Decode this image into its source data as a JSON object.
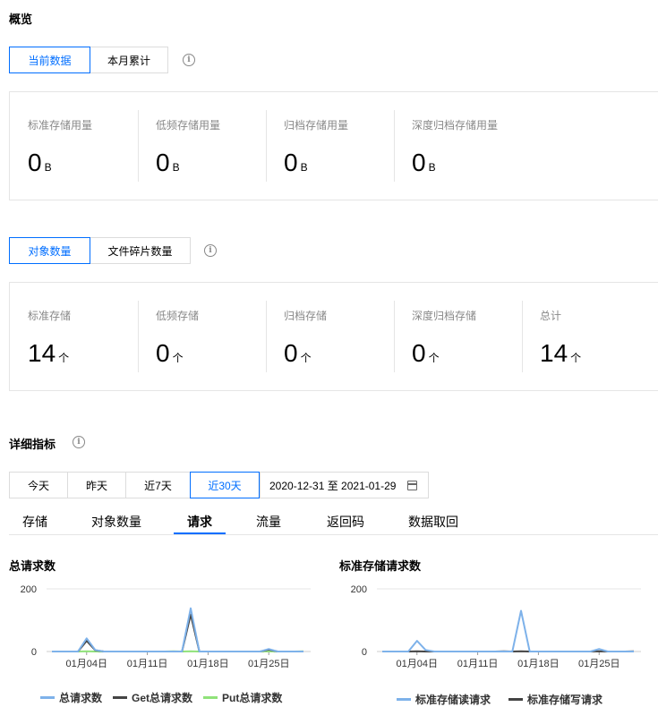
{
  "overview": {
    "title": "概览",
    "toggle": [
      "当前数据",
      "本月累计"
    ],
    "storage_metrics": [
      {
        "label": "标准存储用量",
        "value": "0",
        "unit": "B"
      },
      {
        "label": "低频存储用量",
        "value": "0",
        "unit": "B"
      },
      {
        "label": "归档存储用量",
        "value": "0",
        "unit": "B"
      },
      {
        "label": "深度归档存储用量",
        "value": "0",
        "unit": "B"
      }
    ],
    "count_toggle": [
      "对象数量",
      "文件碎片数量"
    ],
    "count_metrics": [
      {
        "label": "标准存储",
        "value": "14",
        "unit": "个"
      },
      {
        "label": "低频存储",
        "value": "0",
        "unit": "个"
      },
      {
        "label": "归档存储",
        "value": "0",
        "unit": "个"
      },
      {
        "label": "深度归档存储",
        "value": "0",
        "unit": "个"
      },
      {
        "label": "总计",
        "value": "14",
        "unit": "个"
      }
    ]
  },
  "details": {
    "title": "详细指标",
    "range_buttons": [
      "今天",
      "昨天",
      "近7天",
      "近30天"
    ],
    "date_range": "2020-12-31 至 2021-01-29",
    "tabs": [
      "存储",
      "对象数量",
      "请求",
      "流量",
      "返回码",
      "数据取回"
    ],
    "active_tab": "请求"
  },
  "colors": {
    "accent": "#006eff"
  },
  "chart_data": [
    {
      "type": "line",
      "title": "总请求数",
      "x": [
        "12-31",
        "01-01",
        "01-02",
        "01-03",
        "01-04",
        "01-05",
        "01-06",
        "01-07",
        "01-08",
        "01-09",
        "01-10",
        "01-11",
        "01-12",
        "01-13",
        "01-14",
        "01-15",
        "01-16",
        "01-17",
        "01-18",
        "01-19",
        "01-20",
        "01-21",
        "01-22",
        "01-23",
        "01-24",
        "01-25",
        "01-26",
        "01-27",
        "01-28",
        "01-29"
      ],
      "x_ticks": [
        "01月04日",
        "01月11日",
        "01月18日",
        "01月25日"
      ],
      "y_ticks": [
        0,
        200
      ],
      "ylim": [
        0,
        200
      ],
      "series": [
        {
          "name": "总请求数",
          "color": "#7eb2ea",
          "values": [
            0,
            0,
            0,
            0,
            42,
            5,
            0,
            0,
            0,
            0,
            0,
            0,
            0,
            0,
            0,
            0,
            138,
            0,
            0,
            0,
            0,
            0,
            0,
            0,
            0,
            8,
            0,
            0,
            0,
            0
          ]
        },
        {
          "name": "Get总请求数",
          "color": "#444444",
          "values": [
            0,
            0,
            0,
            0,
            34,
            4,
            0,
            0,
            0,
            0,
            0,
            0,
            0,
            0,
            0,
            0,
            118,
            0,
            0,
            0,
            0,
            0,
            0,
            0,
            0,
            6,
            0,
            0,
            0,
            0
          ]
        },
        {
          "name": "Put总请求数",
          "color": "#90e27a",
          "values": [
            0,
            0,
            0,
            0,
            1,
            0,
            0,
            0,
            0,
            0,
            0,
            0,
            0,
            0,
            1,
            0,
            1,
            0,
            0,
            0,
            0,
            0,
            0,
            0,
            0,
            1,
            0,
            0,
            0,
            1
          ]
        }
      ]
    },
    {
      "type": "line",
      "title": "标准存储请求数",
      "x": [
        "12-31",
        "01-01",
        "01-02",
        "01-03",
        "01-04",
        "01-05",
        "01-06",
        "01-07",
        "01-08",
        "01-09",
        "01-10",
        "01-11",
        "01-12",
        "01-13",
        "01-14",
        "01-15",
        "01-16",
        "01-17",
        "01-18",
        "01-19",
        "01-20",
        "01-21",
        "01-22",
        "01-23",
        "01-24",
        "01-25",
        "01-26",
        "01-27",
        "01-28",
        "01-29"
      ],
      "x_ticks": [
        "01月04日",
        "01月11日",
        "01月18日",
        "01月25日"
      ],
      "y_ticks": [
        0,
        200
      ],
      "ylim": [
        0,
        200
      ],
      "series": [
        {
          "name": "标准存储读请求",
          "color": "#7eb2ea",
          "values": [
            0,
            0,
            0,
            0,
            34,
            5,
            0,
            0,
            0,
            0,
            0,
            0,
            0,
            0,
            0,
            0,
            130,
            0,
            0,
            0,
            0,
            0,
            0,
            0,
            0,
            8,
            0,
            0,
            0,
            0
          ]
        },
        {
          "name": "标准存储写请求",
          "color": "#444444",
          "values": [
            0,
            0,
            0,
            0,
            1,
            0,
            0,
            0,
            0,
            0,
            0,
            0,
            0,
            0,
            1,
            0,
            1,
            0,
            0,
            0,
            0,
            0,
            0,
            0,
            0,
            1,
            0,
            0,
            0,
            1
          ]
        }
      ]
    }
  ]
}
